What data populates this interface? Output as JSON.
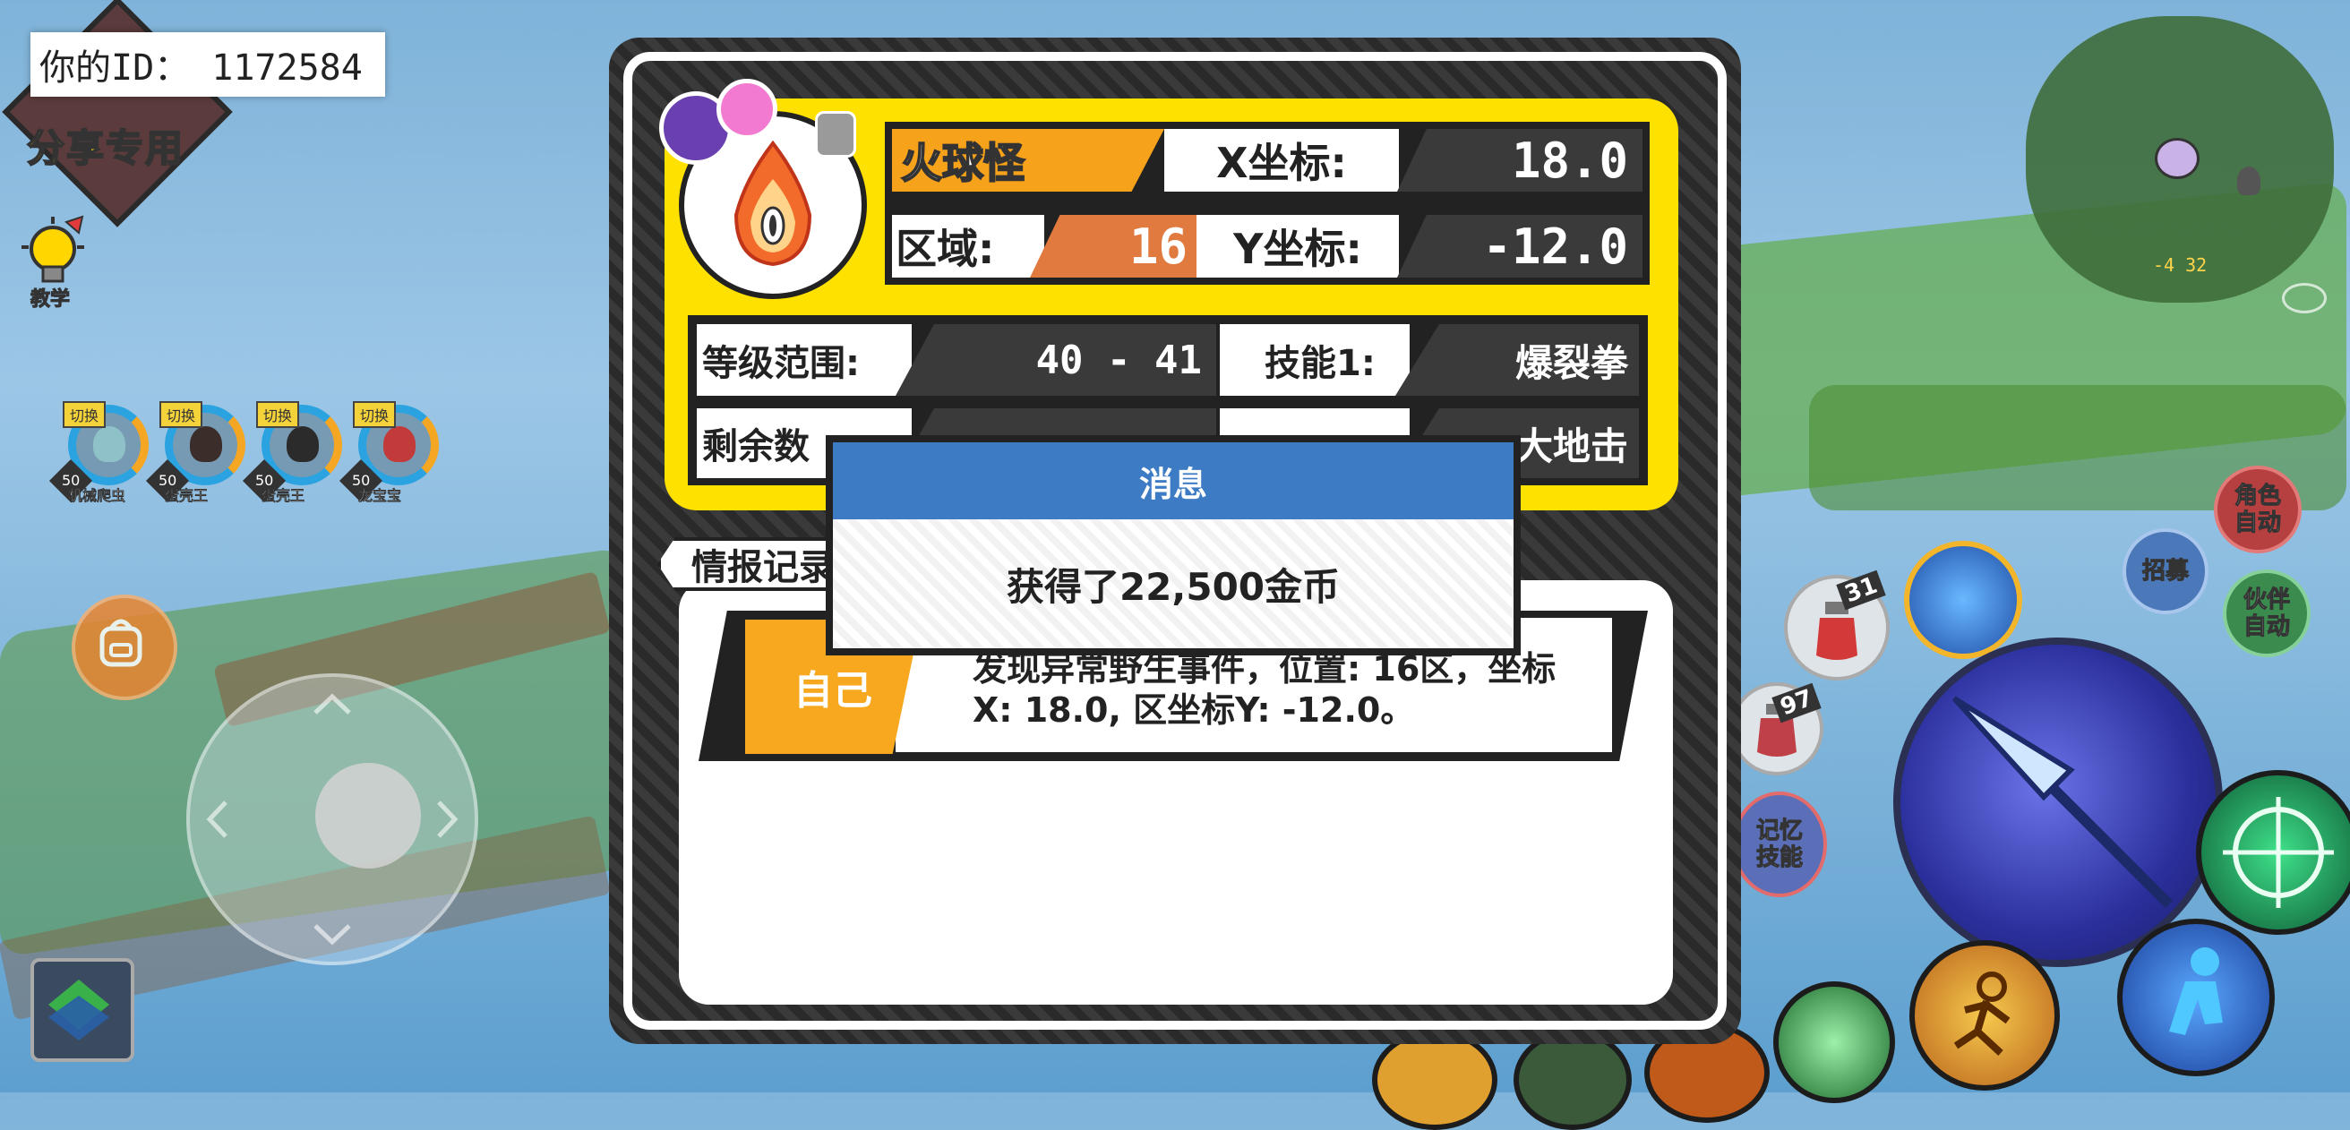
{
  "hud": {
    "player_id": "你的ID： 1172584",
    "share_label": "分享专用",
    "tutorial_label": "教学",
    "minimap_coord": "-4 32"
  },
  "pets": [
    {
      "switch_label": "切换",
      "level": "50",
      "name": "机械爬虫",
      "color": "#8fc2c8"
    },
    {
      "switch_label": "切换",
      "level": "50",
      "name": "蛋壳王",
      "color": "#3a2d2a"
    },
    {
      "switch_label": "切换",
      "level": "50",
      "name": "蛋壳王",
      "color": "#2b2b2b"
    },
    {
      "switch_label": "切换",
      "level": "50",
      "name": "龙宝宝",
      "color": "#c23a3a"
    }
  ],
  "right_buttons": {
    "role_auto": "角色自动",
    "recruit": "招募",
    "partner_auto": "伙伴自动",
    "memory_skill": "记忆技能",
    "potion1_count": "31",
    "potion2_count": "97"
  },
  "info_card": {
    "monster_name": "火球怪",
    "x_label": "X坐标:",
    "x_value": "18.0",
    "area_label": "区域:",
    "area_value": "16",
    "y_label": "Y坐标:",
    "y_value": "-12.0",
    "level_range_label": "等级范围:",
    "level_range_value": "40 - 41",
    "skill1_label": "技能1:",
    "skill1_value": "爆裂拳",
    "remaining_label": "剩余数",
    "skill2_value": "大地击"
  },
  "log": {
    "tab_label": "情报记录",
    "who": "自己",
    "line1": "发现异常野生事件，位置: 16区，坐标",
    "line2": "X: 18.0, 区坐标Y: -12.0。"
  },
  "message": {
    "title": "消息",
    "body": "获得了22,500金币"
  },
  "colors": {
    "card_yellow": "#ffe100",
    "name_orange": "#f7a21b",
    "area_orange": "#e07a3f",
    "dialog_blue": "#3d7bc4"
  }
}
